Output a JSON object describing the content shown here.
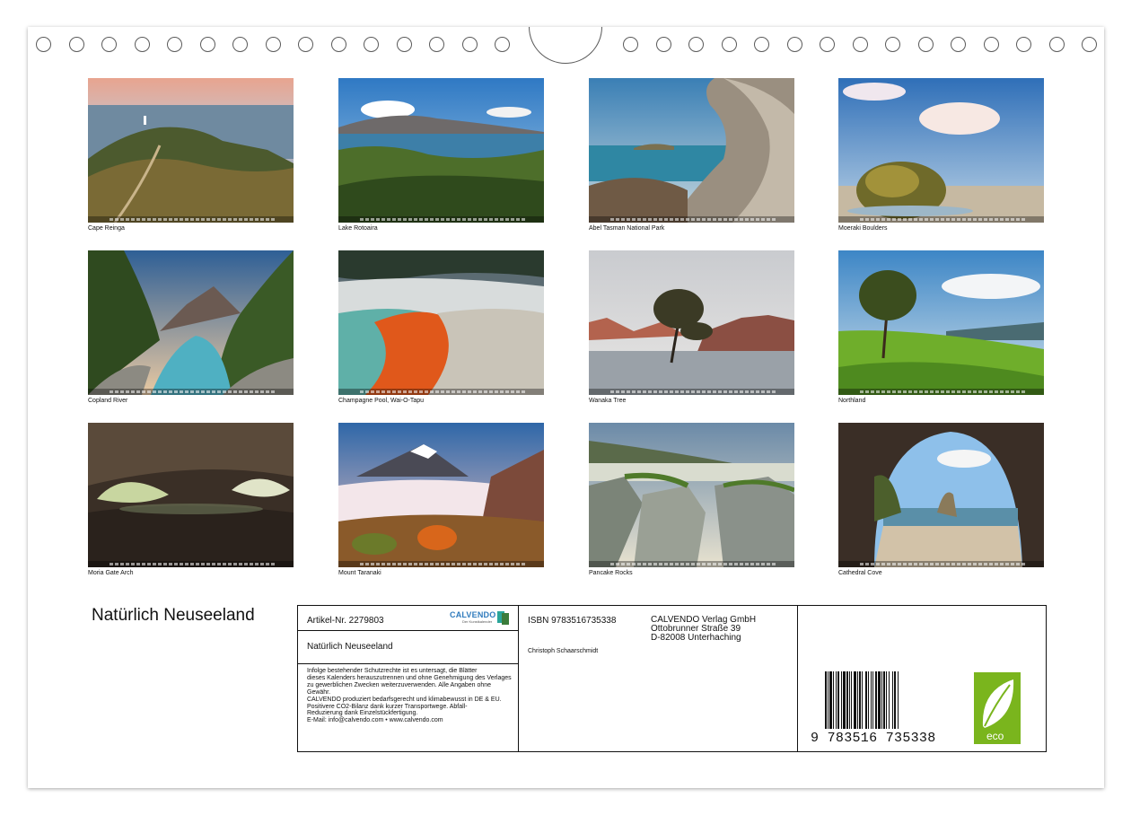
{
  "calendar": {
    "title": "Natürlich Neuseeland",
    "months": [
      {
        "caption": "Cape Reinga",
        "scene": "cape-reinga-icon"
      },
      {
        "caption": "Lake Rotoaira",
        "scene": "lake-icon"
      },
      {
        "caption": "Abel Tasman National Park",
        "scene": "rock-arch-icon"
      },
      {
        "caption": "Moeraki Boulders",
        "scene": "boulder-icon"
      },
      {
        "caption": "Copland River",
        "scene": "river-icon"
      },
      {
        "caption": "Champagne Pool, Wai-O-Tapu",
        "scene": "geothermal-pool-icon"
      },
      {
        "caption": "Wanaka Tree",
        "scene": "lone-tree-lake-icon"
      },
      {
        "caption": "Northland",
        "scene": "tree-hill-icon"
      },
      {
        "caption": "Moria Gate Arch",
        "scene": "cave-arch-icon"
      },
      {
        "caption": "Mount Taranaki",
        "scene": "volcano-icon"
      },
      {
        "caption": "Pancake Rocks",
        "scene": "pancake-rocks-icon"
      },
      {
        "caption": "Cathedral Cove",
        "scene": "sea-cave-icon"
      }
    ]
  },
  "imprint": {
    "article": "Artikel-Nr. 2279803",
    "calvendo_logo_text": "CALVENDO",
    "calvendo_logo_sub": "Der Kunstkalender",
    "product_title": "Natürlich Neuseeland",
    "legal_lines": [
      "Infolge bestehender Schutzrechte ist es untersagt, die Blätter",
      "dieses Kalenders herauszutrennen und ohne Genehmigung des Verlages",
      "zu gewerblichen Zwecken weiterzuverwenden. Alle Angaben ohne",
      "Gewähr.",
      "CALVENDO produziert bedarfsgerecht und klimabewusst in DE & EU.",
      "Positivere CO2-Bilanz dank kurzer Transportwege. Abfall-",
      "Reduzierung dank Einzelstückfertigung.",
      "E-Mail: info@calvendo.com • www.calvendo.com"
    ],
    "isbn": "ISBN 9783516735338",
    "author": "Christoph Schaarschmidt",
    "publisher_lines": [
      "CALVENDO Verlag GmbH",
      "Ottobrunner Straße 39",
      "D-82008 Unterhaching"
    ],
    "barcode_number": "9 783516 735338",
    "eco_label": "eco"
  },
  "colors": {
    "frame": "#111111",
    "calvendo_blue": "#2f7bbd",
    "eco_green": "#7ab51d"
  }
}
